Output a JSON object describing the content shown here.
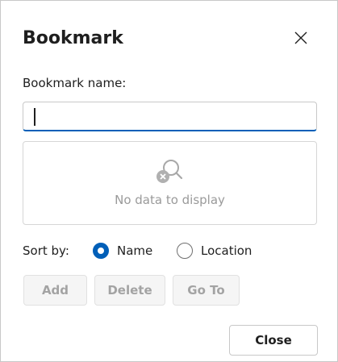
{
  "dialog": {
    "title": "Bookmark",
    "close_icon": "close-icon",
    "name_label": "Bookmark name:",
    "name_value": "",
    "list": {
      "empty_icon": "search-cross-icon",
      "empty_text": "No data to display"
    },
    "sort": {
      "label": "Sort by:",
      "options": [
        {
          "label": "Name",
          "selected": true
        },
        {
          "label": "Location",
          "selected": false
        }
      ]
    },
    "buttons": {
      "add": "Add",
      "delete": "Delete",
      "goto": "Go To",
      "close": "Close"
    }
  },
  "colors": {
    "accent": "#005fb8",
    "disabled_text": "#a3a3a3",
    "placeholder_text": "#9a9a9a"
  }
}
